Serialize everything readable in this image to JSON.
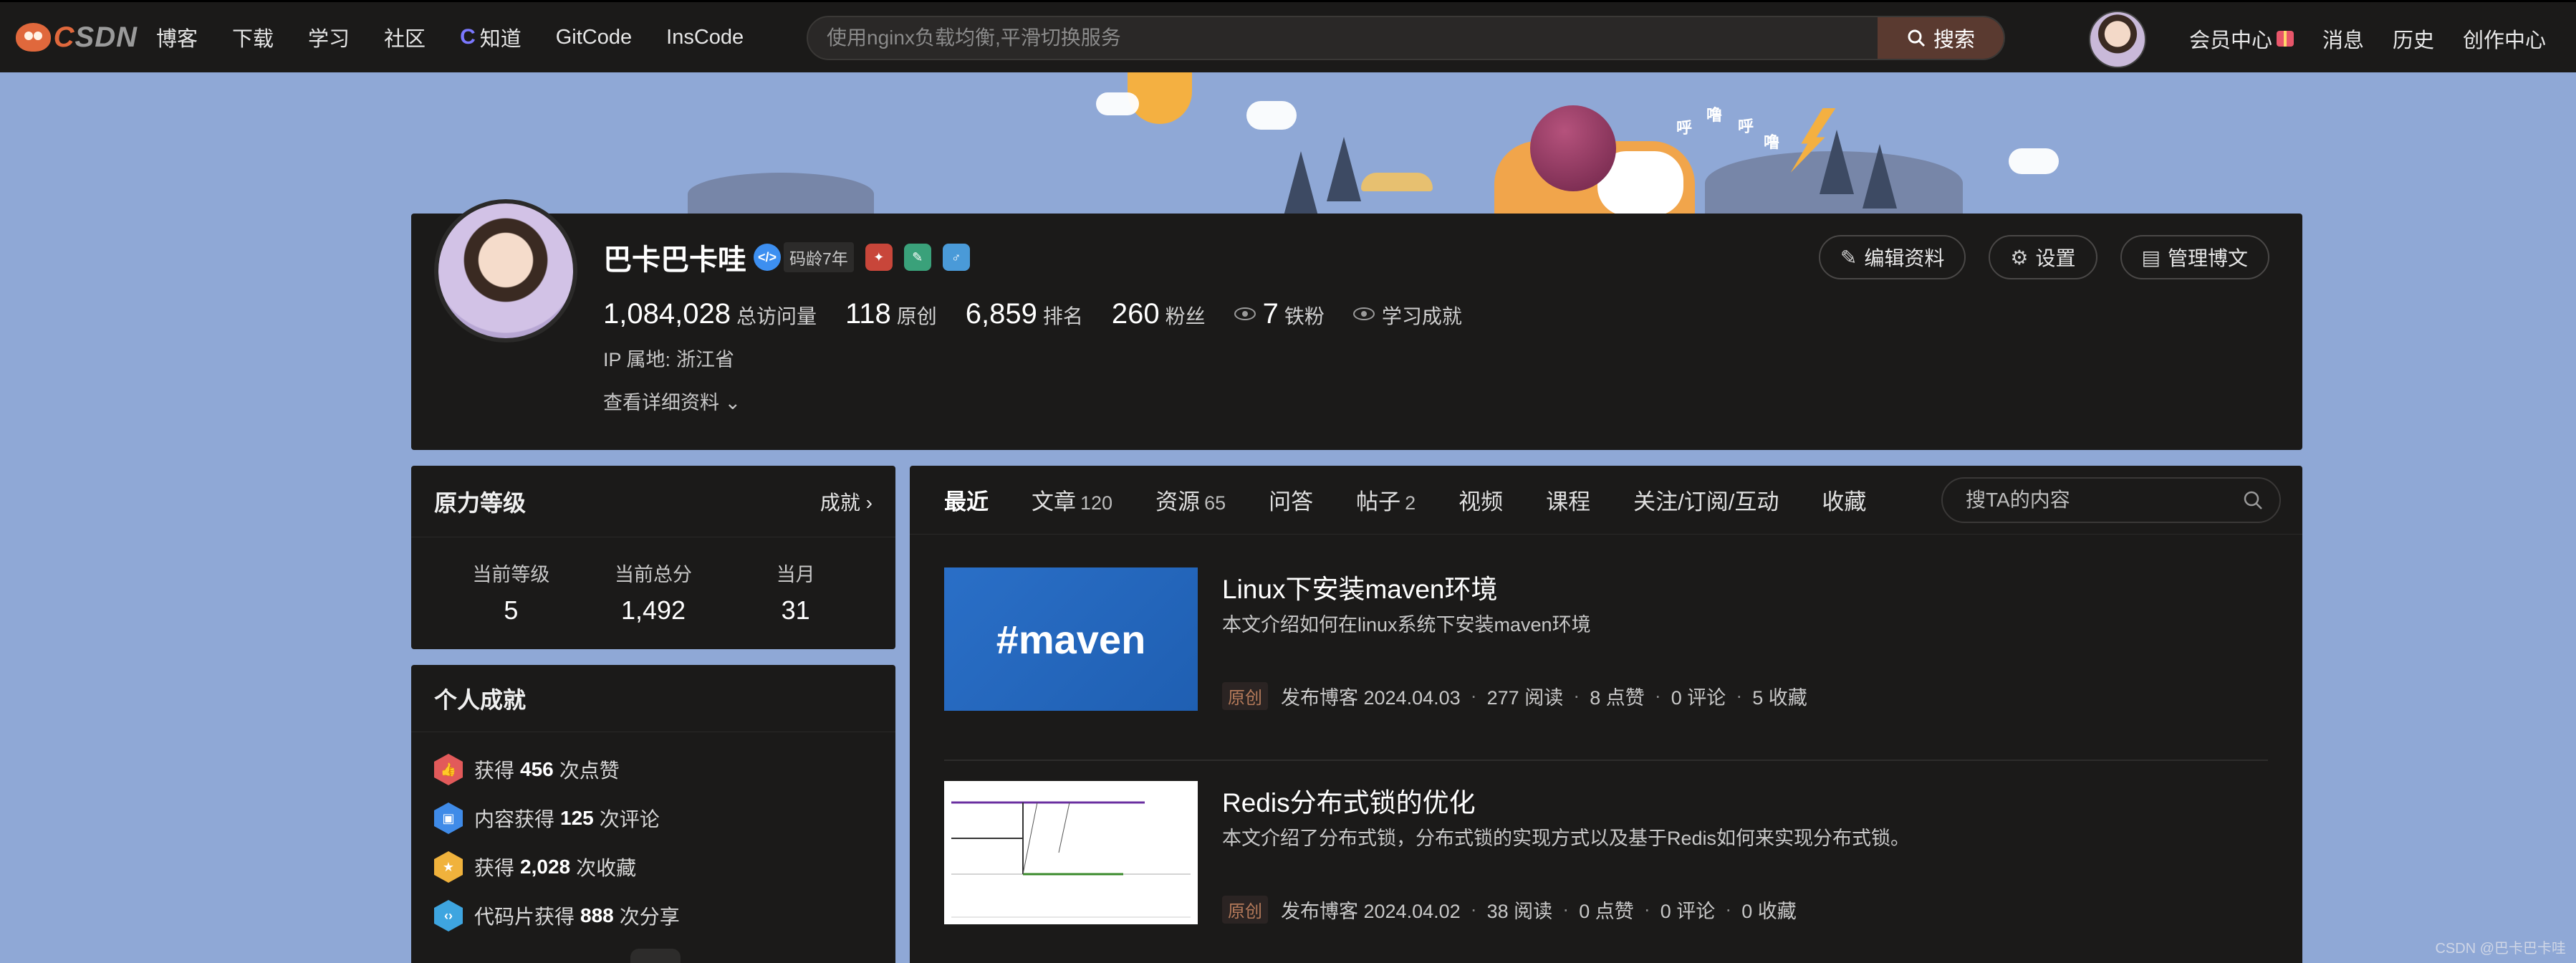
{
  "topbar": {
    "logo_text_a": "C",
    "logo_text_b": "SDN",
    "nav": [
      "博客",
      "下载",
      "学习",
      "社区",
      "知道",
      "GitCode",
      "InsCode"
    ],
    "search_placeholder": "使用nginx负载均衡,平滑切换服务",
    "search_button": "搜索",
    "right_links": [
      "会员中心",
      "消息",
      "历史",
      "创作中心"
    ]
  },
  "banner": {
    "onomatopoeia": [
      "呼",
      "噜",
      "呼",
      "噜"
    ]
  },
  "profile": {
    "name": "巴卡巴卡哇",
    "verified_icon": "verified-icon",
    "code_age": "码龄7年",
    "stats": [
      {
        "num": "1,084,028",
        "label": "总访问量"
      },
      {
        "num": "118",
        "label": "原创"
      },
      {
        "num": "6,859",
        "label": "排名"
      },
      {
        "num": "260",
        "label": "粉丝"
      },
      {
        "num": "7",
        "label": "铁粉"
      }
    ],
    "learning": "学习成就",
    "ip_label": "IP 属地:",
    "ip_value": "浙江省",
    "detail_link": "查看详细资料",
    "buttons": [
      "编辑资料",
      "设置",
      "管理博文"
    ]
  },
  "level": {
    "title": "原力等级",
    "link": "成就",
    "items": [
      {
        "label": "当前等级",
        "value": "5"
      },
      {
        "label": "当前总分",
        "value": "1,492"
      },
      {
        "label": "当月",
        "value": "31"
      }
    ]
  },
  "achievements": {
    "title": "个人成就",
    "items": [
      {
        "pre": "获得",
        "num": "456",
        "post": "次点赞",
        "color": "#e25a5a"
      },
      {
        "pre": "内容获得",
        "num": "125",
        "post": "次评论",
        "color": "#3f8be8"
      },
      {
        "pre": "获得",
        "num": "2,028",
        "post": "次收藏",
        "color": "#f0b23c"
      },
      {
        "pre": "代码片获得",
        "num": "888",
        "post": "次分享",
        "color": "#3ea5e0"
      }
    ]
  },
  "tabs": [
    {
      "label": "最近",
      "count": ""
    },
    {
      "label": "文章",
      "count": "120"
    },
    {
      "label": "资源",
      "count": "65"
    },
    {
      "label": "问答",
      "count": ""
    },
    {
      "label": "帖子",
      "count": "2"
    },
    {
      "label": "视频",
      "count": ""
    },
    {
      "label": "课程",
      "count": ""
    },
    {
      "label": "关注/订阅/互动",
      "count": ""
    },
    {
      "label": "收藏",
      "count": ""
    }
  ],
  "tab_search_placeholder": "搜TA的内容",
  "articles": [
    {
      "thumb_text": "#maven",
      "title": "Linux下安装maven环境",
      "desc": "本文介绍如何在linux系统下安装maven环境",
      "tag": "原创",
      "published": "发布博客 2024.04.03",
      "reads": "277 阅读",
      "likes": "8 点赞",
      "comments": "0 评论",
      "favs": "5 收藏"
    },
    {
      "thumb_text": "",
      "title": "Redis分布式锁的优化",
      "desc": "本文介绍了分布式锁，分布式锁的实现方式以及基于Redis如何来实现分布式锁。",
      "tag": "原创",
      "published": "发布博客 2024.04.02",
      "reads": "38 阅读",
      "likes": "0 点赞",
      "comments": "0 评论",
      "favs": "0 收藏"
    }
  ],
  "watermark": "CSDN @巴卡巴卡哇",
  "colors": {
    "accent": "#e0683c",
    "search_button": "#5a3a30",
    "page_bg": "#8fa8d6",
    "card_bg": "#1b1a19"
  }
}
